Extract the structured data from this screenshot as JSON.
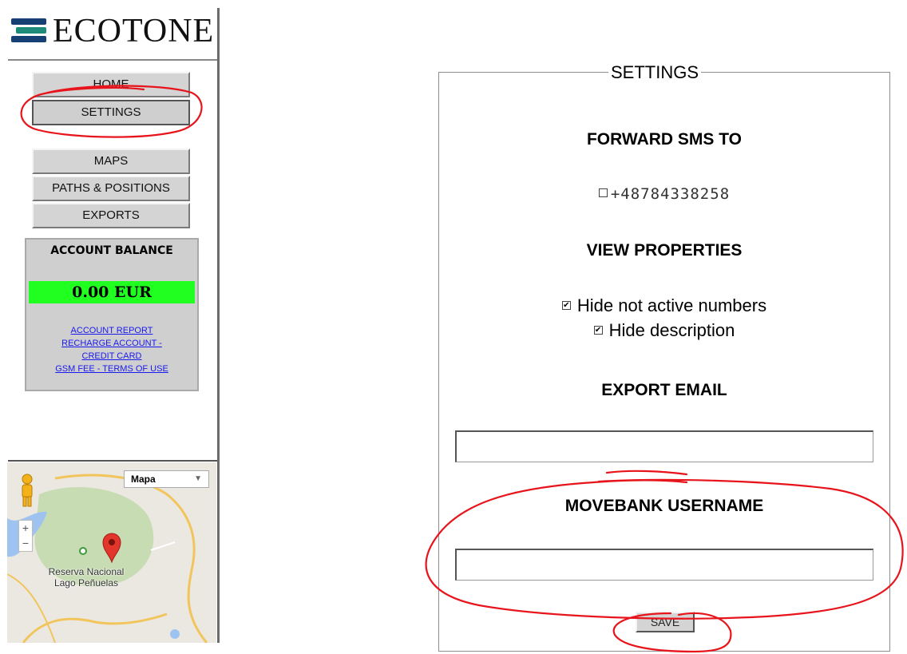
{
  "logo": {
    "text": "ECOTONE"
  },
  "nav": {
    "home": "HOME",
    "settings": "SETTINGS",
    "maps": "MAPS",
    "paths": "PATHS & POSITIONS",
    "exports": "EXPORTS"
  },
  "account": {
    "title": "ACCOUNT BALANCE",
    "balance": "0.00 EUR",
    "links": {
      "report": "ACCOUNT REPORT",
      "recharge_1": "RECHARGE ACCOUNT -",
      "recharge_2": "CREDIT CARD",
      "gsm": "GSM FEE - TERMS OF USE"
    }
  },
  "map": {
    "type_selector": "Mapa",
    "place_label_1": "Reserva Nacional",
    "place_label_2": "Lago Peñuelas",
    "zoom_in": "+",
    "zoom_out": "−"
  },
  "settings": {
    "legend": "SETTINGS",
    "forward_heading": "FORWARD SMS TO",
    "phone_number": "+48784338258",
    "phone_checked": false,
    "view_heading": "VIEW PROPERTIES",
    "hide_numbers_label": "Hide not active numbers",
    "hide_numbers_checked": true,
    "hide_description_label": "Hide description",
    "hide_description_checked": true,
    "export_heading": "EXPORT EMAIL",
    "export_email_value": "",
    "movebank_heading": "MOVEBANK USERNAME",
    "movebank_value": "",
    "save_label": "SAVE"
  },
  "colors": {
    "balance_bg": "#21ff21",
    "link": "#1a1aee",
    "annotation": "#e8141b"
  }
}
